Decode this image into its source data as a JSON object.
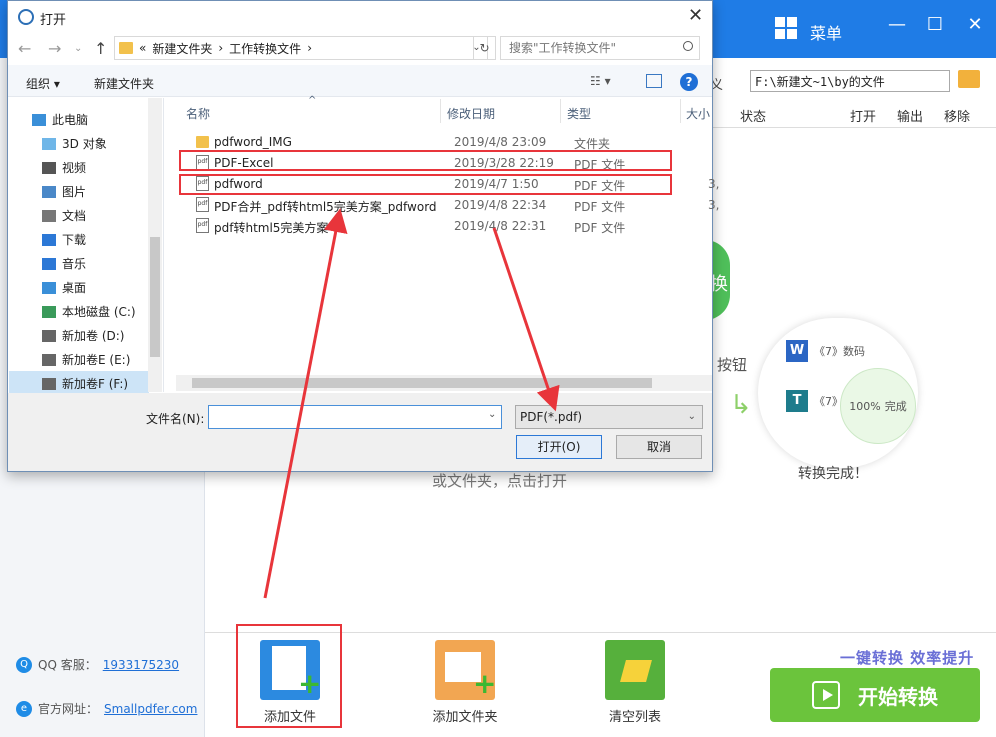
{
  "app": {
    "menu_label": "菜单",
    "path_label": "义",
    "path_value": "F:\\新建文~1\\by的文件",
    "columns": {
      "status": "状态",
      "open": "打开",
      "output": "输出",
      "remove": "移除"
    },
    "hint": "或文件夹，点击打开",
    "illustration": {
      "button_hint": "按钮",
      "green_text": "换",
      "row1_text": "《7》数码",
      "row2_text": "《7》",
      "progress_value": "100%",
      "progress_label": "完成",
      "done_text": "转换完成！"
    },
    "contact": {
      "qq_label": "QQ 客服：",
      "qq_value": "1933175230",
      "web_label": "官方网址：",
      "web_value": "Smallpdfer.com"
    },
    "tools": {
      "add_file": "添加文件",
      "add_folder": "添加文件夹",
      "clear_list": "清空列表"
    },
    "slogan": "一键转换  效率提升",
    "start_label": "开始转换"
  },
  "dialog": {
    "title": "打开",
    "breadcrumb": {
      "prefix": "«",
      "parent": "新建文件夹",
      "current": "工作转换文件"
    },
    "search_placeholder": "搜索\"工作转换文件\"",
    "toolbar": {
      "organize": "组织 ▾",
      "new_folder": "新建文件夹"
    },
    "nav": [
      {
        "label": "此电脑"
      },
      {
        "label": "3D 对象"
      },
      {
        "label": "视频"
      },
      {
        "label": "图片"
      },
      {
        "label": "文档"
      },
      {
        "label": "下载"
      },
      {
        "label": "音乐"
      },
      {
        "label": "桌面"
      },
      {
        "label": "本地磁盘 (C:)"
      },
      {
        "label": "新加卷 (D:)"
      },
      {
        "label": "新加卷E (E:)"
      },
      {
        "label": "新加卷F (F:)"
      }
    ],
    "headers": {
      "name": "名称",
      "date": "修改日期",
      "type": "类型",
      "size": "大小"
    },
    "files": [
      {
        "name": "pdfword_IMG",
        "date": "2019/4/8 23:09",
        "type": "文件夹",
        "size": "",
        "kind": "folder"
      },
      {
        "name": "PDF-Excel",
        "date": "2019/3/28 22:19",
        "type": "PDF 文件",
        "size": "",
        "kind": "pdf"
      },
      {
        "name": "pdfword",
        "date": "2019/4/7 1:50",
        "type": "PDF 文件",
        "size": "3,",
        "kind": "pdf"
      },
      {
        "name": "PDF合并_pdf转html5完美方案_pdfword",
        "date": "2019/4/8 22:34",
        "type": "PDF 文件",
        "size": "3,",
        "kind": "pdf"
      },
      {
        "name": "pdf转html5完美方案",
        "date": "2019/4/8 22:31",
        "type": "PDF 文件",
        "size": "",
        "kind": "pdf"
      }
    ],
    "filename_label": "文件名(N):",
    "filename_value": "",
    "filetype_value": "PDF(*.pdf)",
    "open_label": "打开(O)",
    "cancel_label": "取消"
  },
  "colors": {
    "accent": "#1f7ce6",
    "start_green": "#6bc43c",
    "annotation_red": "#e8353b"
  }
}
